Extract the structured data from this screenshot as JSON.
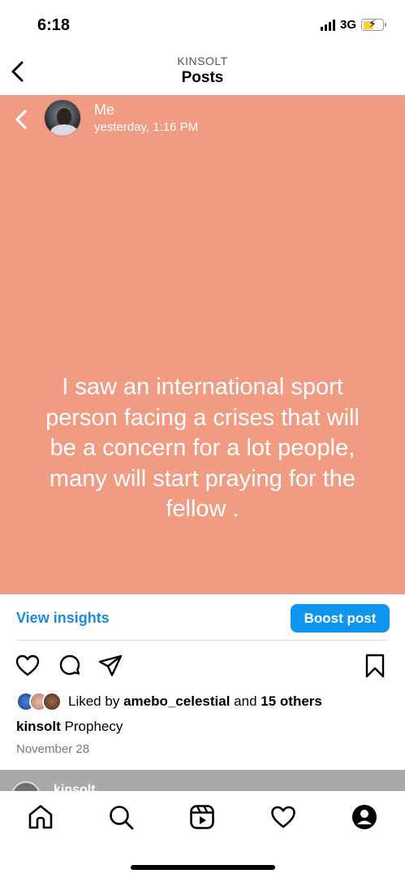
{
  "status_bar": {
    "time": "6:18",
    "network": "3G",
    "battery_level": 0.55,
    "battery_color": "#f7d23a"
  },
  "header": {
    "subtitle": "KINSOLT",
    "title": "Posts",
    "back_icon": "chevron-left-icon"
  },
  "story": {
    "background_color": "#f09b82",
    "author": "Me",
    "timestamp": "yesterday, 1:16 PM",
    "lines": [
      "I saw an international sport",
      "person facing a crises that will",
      "be a concern for a lot people,",
      "many will start praying for the",
      "fellow ."
    ]
  },
  "insights": {
    "view_label": "View insights",
    "boost_label": "Boost post",
    "accent_color": "#0d95f0"
  },
  "actions": {
    "like_icon": "heart-icon",
    "comment_icon": "comment-icon",
    "share_icon": "send-icon",
    "save_icon": "bookmark-icon"
  },
  "likes": {
    "prefix": "Liked by",
    "user": "amebo_celestial",
    "joiner": "and",
    "others": "15 others"
  },
  "caption": {
    "username": "kinsolt",
    "text": "Prophecy"
  },
  "date": "November 28",
  "next_post": {
    "username": "kinsolt"
  },
  "tabbar": {
    "items": [
      "home-icon",
      "search-icon",
      "reels-icon",
      "activity-heart-icon",
      "profile-icon"
    ]
  }
}
